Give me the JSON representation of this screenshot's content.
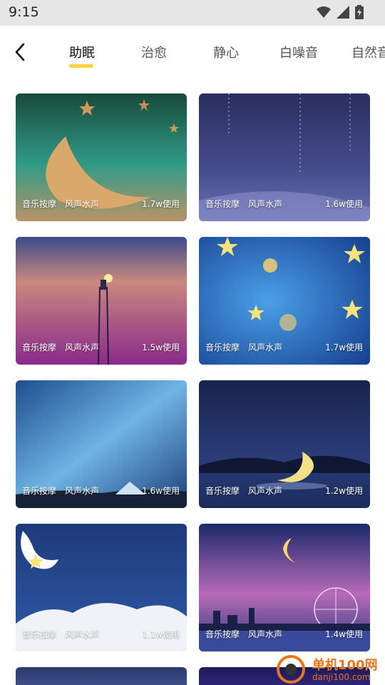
{
  "status_bar": {
    "time": "9:15"
  },
  "tabs": [
    {
      "label": "助眠",
      "active": true
    },
    {
      "label": "治愈",
      "active": false
    },
    {
      "label": "静心",
      "active": false
    },
    {
      "label": "白噪音",
      "active": false
    },
    {
      "label": "自然音",
      "active": false
    }
  ],
  "accent_color": "#ffd23f",
  "cards": [
    {
      "tag1": "音乐按摩",
      "tag2": "风声水声",
      "usage": "1.7w使用"
    },
    {
      "tag1": "音乐按摩",
      "tag2": "风声水声",
      "usage": "1.6w使用"
    },
    {
      "tag1": "音乐按摩",
      "tag2": "风声水声",
      "usage": "1.5w使用"
    },
    {
      "tag1": "音乐按摩",
      "tag2": "风声水声",
      "usage": "1.7w使用"
    },
    {
      "tag1": "音乐按摩",
      "tag2": "风声水声",
      "usage": "1.6w使用"
    },
    {
      "tag1": "音乐按摩",
      "tag2": "风声水声",
      "usage": "1.2w使用"
    },
    {
      "tag1": "音乐按摩",
      "tag2": "风声水声",
      "usage": "1.1w使用"
    },
    {
      "tag1": "音乐按摩",
      "tag2": "风声水声",
      "usage": "1.4w使用"
    }
  ],
  "watermark": {
    "name": "单机100网",
    "url": "danji100.com"
  }
}
